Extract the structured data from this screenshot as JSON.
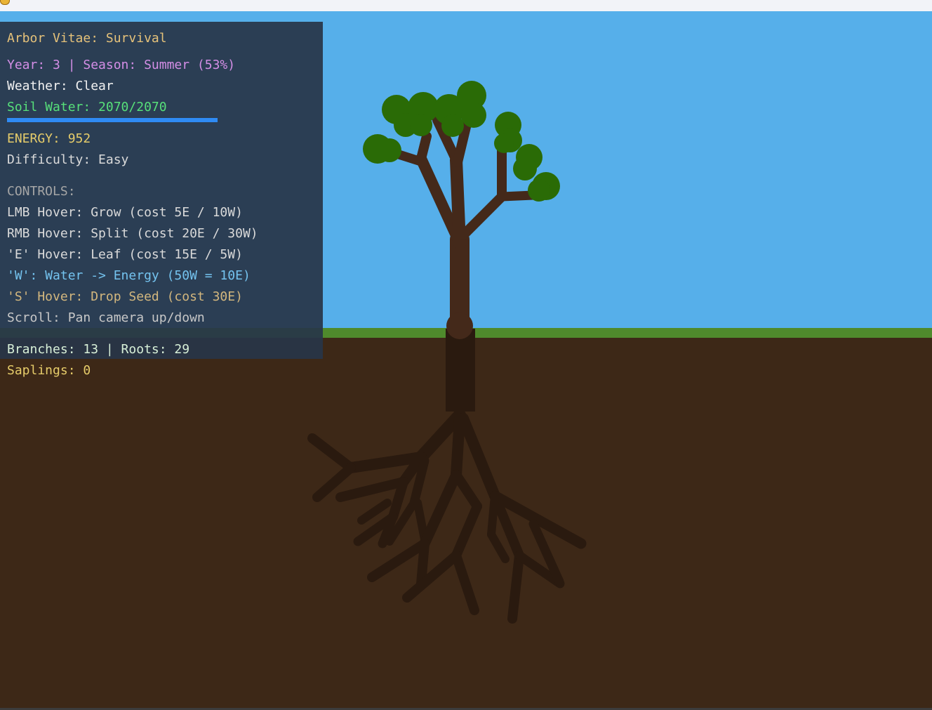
{
  "window": {
    "icon": "app-icon"
  },
  "colors": {
    "sky": "#56afea",
    "grass": "#4f8a2c",
    "soil": "#3d2817",
    "trunk": "#44291a",
    "root": "#2a1a0f",
    "leaf": "#2a6b06",
    "hud_bg": "#283648",
    "title": "#e6c27a",
    "season": "#d48ee6",
    "weather": "#f2f2f2",
    "soil_water": "#57e07a",
    "water_bar": "#2f8bf4",
    "energy": "#e6cc6a",
    "difficulty": "#dadada",
    "controls_header": "#a6a6a6",
    "control": "#dadada",
    "water_control": "#74c3ef",
    "seed_control": "#d3b77e",
    "stats": "#d8f0d8",
    "saplings": "#e6cc6a"
  },
  "hud": {
    "title": "Arbor Vitae: Survival",
    "season_line": "Year: 3 | Season: Summer (53%)",
    "season_progress": 0.53,
    "weather": "Weather: Clear",
    "soil_water": "Soil Water: 2070/2070",
    "soil_water_fraction": 1.0,
    "energy": "ENERGY: 952",
    "difficulty": "Difficulty: Easy",
    "controls_header": "CONTROLS:",
    "controls": [
      "LMB Hover: Grow (cost 5E / 10W)",
      "RMB Hover: Split (cost 20E / 30W)",
      "'E' Hover: Leaf (cost 15E / 5W)",
      "'W': Water -> Energy (50W = 10E)",
      "'S' Hover: Drop Seed (cost 30E)",
      "Scroll: Pan camera up/down"
    ],
    "stats": "Branches: 13 | Roots: 29",
    "saplings": "Saplings: 0"
  }
}
